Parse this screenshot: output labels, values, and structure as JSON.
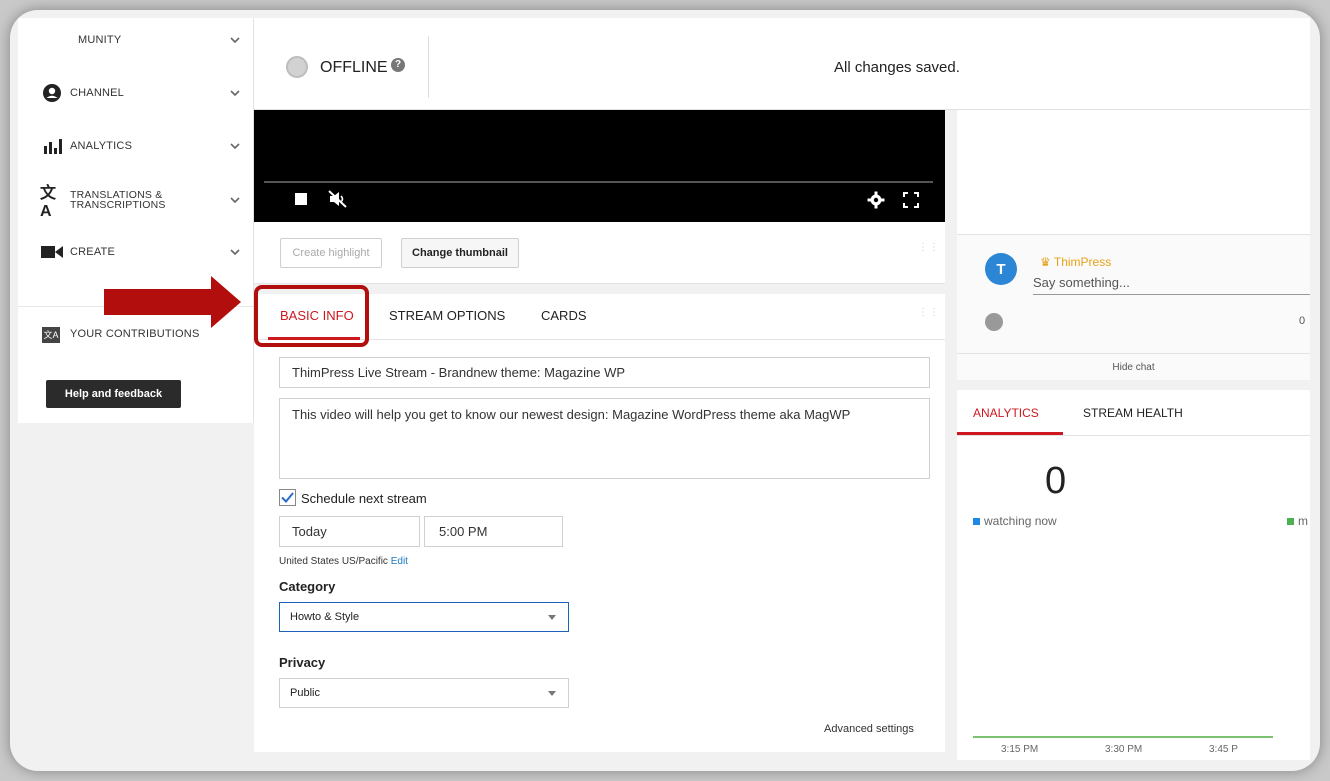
{
  "sidebar": {
    "items": [
      {
        "label": "MUNITY",
        "icon": "community-icon"
      },
      {
        "label": "CHANNEL",
        "icon": "account-circle-icon"
      },
      {
        "label": "ANALYTICS",
        "icon": "bar-chart-icon"
      },
      {
        "label": "TRANSLATIONS &\nTRANSCRIPTIONS",
        "icon": "translate-icon"
      },
      {
        "label": "CREATE",
        "icon": "video-camera-icon"
      }
    ],
    "contributions_label": "YOUR CONTRIBUTIONS",
    "help_label": "Help and feedback"
  },
  "status": {
    "state": "OFFLINE",
    "saved": "All changes saved."
  },
  "toolbar": {
    "create_highlight": "Create highlight",
    "change_thumbnail": "Change thumbnail"
  },
  "tabs": {
    "basic_info": "BASIC INFO",
    "stream_options": "STREAM OPTIONS",
    "cards": "CARDS"
  },
  "form": {
    "title": "ThimPress Live Stream - Brandnew theme: Magazine WP",
    "description": "This video will help you get to know our newest design: Magazine WordPress theme aka MagWP",
    "schedule_label": "Schedule next stream",
    "date": "Today",
    "time": "5:00 PM",
    "timezone": "United States US/Pacific",
    "timezone_edit": "Edit",
    "category_label": "Category",
    "category_value": "Howto & Style",
    "privacy_label": "Privacy",
    "privacy_value": "Public",
    "advanced": "Advanced settings"
  },
  "chat": {
    "user": "ThimPress",
    "avatar_text": "T",
    "placeholder": "Say something...",
    "counter": "0",
    "hide": "Hide chat"
  },
  "analytics": {
    "tab_analytics": "ANALYTICS",
    "tab_health": "STREAM HEALTH",
    "count": "0",
    "legend_watching": "watching now",
    "legend_other": "m",
    "ticks": [
      "3:15 PM",
      "3:30 PM",
      "3:45 P"
    ],
    "colors": {
      "watching": "#1e88e5",
      "other": "#4caf50"
    }
  },
  "colors": {
    "accent": "#cc181e",
    "annotation": "#b20e0e"
  }
}
